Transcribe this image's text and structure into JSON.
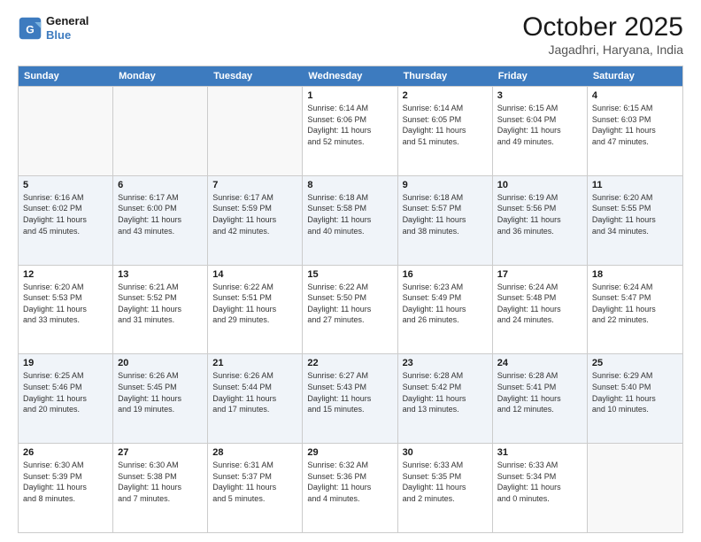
{
  "header": {
    "logo_line1": "General",
    "logo_line2": "Blue",
    "month_title": "October 2025",
    "location": "Jagadhri, Haryana, India"
  },
  "weekdays": [
    "Sunday",
    "Monday",
    "Tuesday",
    "Wednesday",
    "Thursday",
    "Friday",
    "Saturday"
  ],
  "rows": [
    {
      "alt": false,
      "cells": [
        {
          "day": "",
          "info": ""
        },
        {
          "day": "",
          "info": ""
        },
        {
          "day": "",
          "info": ""
        },
        {
          "day": "1",
          "info": "Sunrise: 6:14 AM\nSunset: 6:06 PM\nDaylight: 11 hours\nand 52 minutes."
        },
        {
          "day": "2",
          "info": "Sunrise: 6:14 AM\nSunset: 6:05 PM\nDaylight: 11 hours\nand 51 minutes."
        },
        {
          "day": "3",
          "info": "Sunrise: 6:15 AM\nSunset: 6:04 PM\nDaylight: 11 hours\nand 49 minutes."
        },
        {
          "day": "4",
          "info": "Sunrise: 6:15 AM\nSunset: 6:03 PM\nDaylight: 11 hours\nand 47 minutes."
        }
      ]
    },
    {
      "alt": true,
      "cells": [
        {
          "day": "5",
          "info": "Sunrise: 6:16 AM\nSunset: 6:02 PM\nDaylight: 11 hours\nand 45 minutes."
        },
        {
          "day": "6",
          "info": "Sunrise: 6:17 AM\nSunset: 6:00 PM\nDaylight: 11 hours\nand 43 minutes."
        },
        {
          "day": "7",
          "info": "Sunrise: 6:17 AM\nSunset: 5:59 PM\nDaylight: 11 hours\nand 42 minutes."
        },
        {
          "day": "8",
          "info": "Sunrise: 6:18 AM\nSunset: 5:58 PM\nDaylight: 11 hours\nand 40 minutes."
        },
        {
          "day": "9",
          "info": "Sunrise: 6:18 AM\nSunset: 5:57 PM\nDaylight: 11 hours\nand 38 minutes."
        },
        {
          "day": "10",
          "info": "Sunrise: 6:19 AM\nSunset: 5:56 PM\nDaylight: 11 hours\nand 36 minutes."
        },
        {
          "day": "11",
          "info": "Sunrise: 6:20 AM\nSunset: 5:55 PM\nDaylight: 11 hours\nand 34 minutes."
        }
      ]
    },
    {
      "alt": false,
      "cells": [
        {
          "day": "12",
          "info": "Sunrise: 6:20 AM\nSunset: 5:53 PM\nDaylight: 11 hours\nand 33 minutes."
        },
        {
          "day": "13",
          "info": "Sunrise: 6:21 AM\nSunset: 5:52 PM\nDaylight: 11 hours\nand 31 minutes."
        },
        {
          "day": "14",
          "info": "Sunrise: 6:22 AM\nSunset: 5:51 PM\nDaylight: 11 hours\nand 29 minutes."
        },
        {
          "day": "15",
          "info": "Sunrise: 6:22 AM\nSunset: 5:50 PM\nDaylight: 11 hours\nand 27 minutes."
        },
        {
          "day": "16",
          "info": "Sunrise: 6:23 AM\nSunset: 5:49 PM\nDaylight: 11 hours\nand 26 minutes."
        },
        {
          "day": "17",
          "info": "Sunrise: 6:24 AM\nSunset: 5:48 PM\nDaylight: 11 hours\nand 24 minutes."
        },
        {
          "day": "18",
          "info": "Sunrise: 6:24 AM\nSunset: 5:47 PM\nDaylight: 11 hours\nand 22 minutes."
        }
      ]
    },
    {
      "alt": true,
      "cells": [
        {
          "day": "19",
          "info": "Sunrise: 6:25 AM\nSunset: 5:46 PM\nDaylight: 11 hours\nand 20 minutes."
        },
        {
          "day": "20",
          "info": "Sunrise: 6:26 AM\nSunset: 5:45 PM\nDaylight: 11 hours\nand 19 minutes."
        },
        {
          "day": "21",
          "info": "Sunrise: 6:26 AM\nSunset: 5:44 PM\nDaylight: 11 hours\nand 17 minutes."
        },
        {
          "day": "22",
          "info": "Sunrise: 6:27 AM\nSunset: 5:43 PM\nDaylight: 11 hours\nand 15 minutes."
        },
        {
          "day": "23",
          "info": "Sunrise: 6:28 AM\nSunset: 5:42 PM\nDaylight: 11 hours\nand 13 minutes."
        },
        {
          "day": "24",
          "info": "Sunrise: 6:28 AM\nSunset: 5:41 PM\nDaylight: 11 hours\nand 12 minutes."
        },
        {
          "day": "25",
          "info": "Sunrise: 6:29 AM\nSunset: 5:40 PM\nDaylight: 11 hours\nand 10 minutes."
        }
      ]
    },
    {
      "alt": false,
      "cells": [
        {
          "day": "26",
          "info": "Sunrise: 6:30 AM\nSunset: 5:39 PM\nDaylight: 11 hours\nand 8 minutes."
        },
        {
          "day": "27",
          "info": "Sunrise: 6:30 AM\nSunset: 5:38 PM\nDaylight: 11 hours\nand 7 minutes."
        },
        {
          "day": "28",
          "info": "Sunrise: 6:31 AM\nSunset: 5:37 PM\nDaylight: 11 hours\nand 5 minutes."
        },
        {
          "day": "29",
          "info": "Sunrise: 6:32 AM\nSunset: 5:36 PM\nDaylight: 11 hours\nand 4 minutes."
        },
        {
          "day": "30",
          "info": "Sunrise: 6:33 AM\nSunset: 5:35 PM\nDaylight: 11 hours\nand 2 minutes."
        },
        {
          "day": "31",
          "info": "Sunrise: 6:33 AM\nSunset: 5:34 PM\nDaylight: 11 hours\nand 0 minutes."
        },
        {
          "day": "",
          "info": ""
        }
      ]
    }
  ]
}
